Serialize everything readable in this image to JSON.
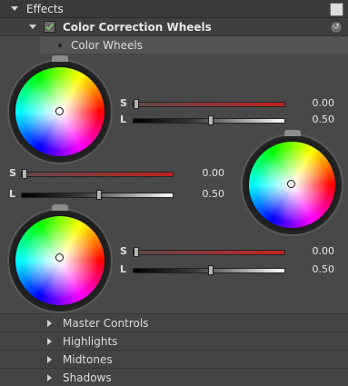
{
  "effects_header": {
    "label": "Effects"
  },
  "effect": {
    "label": "Color Correction Wheels",
    "enabled": true
  },
  "subgroup": {
    "label": "Color Wheels"
  },
  "wheels": [
    {
      "name": "wheel-1",
      "s_label": "S",
      "s_value": "0.00",
      "l_label": "L",
      "l_value": "0.50"
    },
    {
      "name": "wheel-2",
      "s_label": "S",
      "s_value": "0.00",
      "l_label": "L",
      "l_value": "0.50"
    },
    {
      "name": "wheel-3",
      "s_label": "S",
      "s_value": "0.00",
      "l_label": "L",
      "l_value": "0.50"
    }
  ],
  "sections": [
    "Master Controls",
    "Highlights",
    "Midtones",
    "Shadows"
  ],
  "colors": {
    "accent_saturation": "#c42020",
    "panel_bg": "#484848"
  }
}
